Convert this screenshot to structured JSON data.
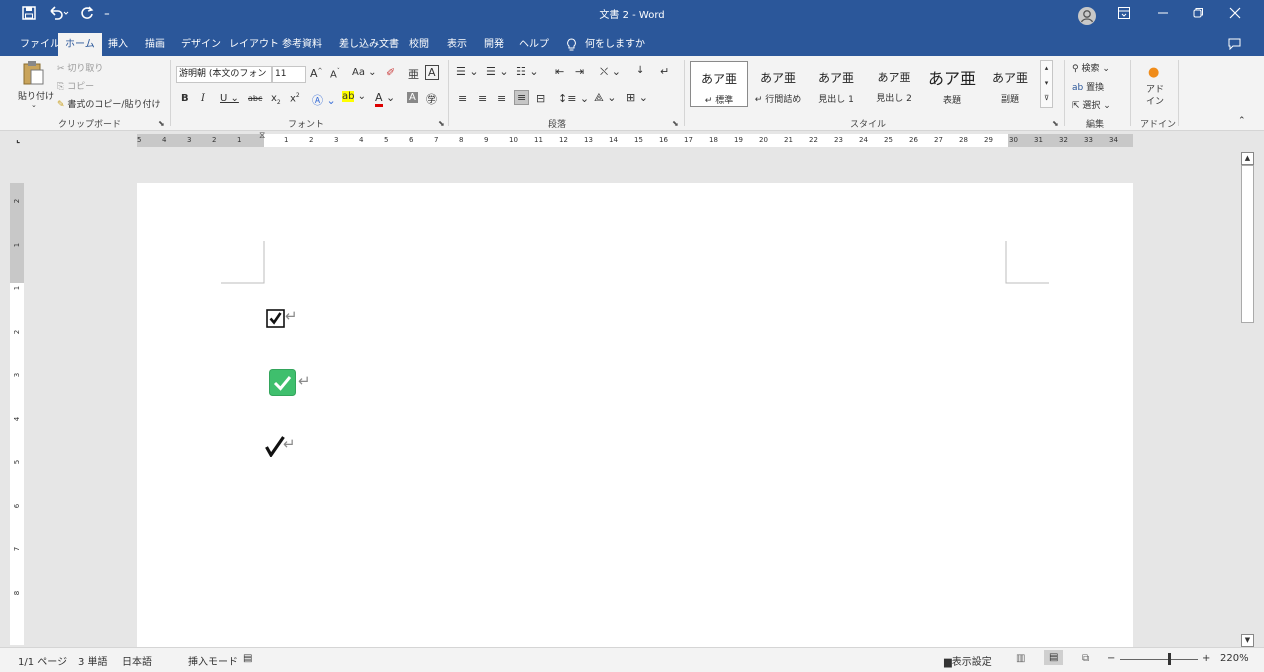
{
  "titlebar": {
    "title": "文書 2  -  Word",
    "save_icon": "floppy-icon",
    "undo_icon": "undo-icon",
    "redo_icon": "redo-icon",
    "qat_more": "⁼"
  },
  "tabs": [
    "ファイル",
    "ホーム",
    "挿入",
    "描画",
    "デザイン",
    "レイアウト",
    "参考資料",
    "差し込み文書",
    "校閲",
    "表示",
    "開発",
    "ヘルプ"
  ],
  "tell_me": "何をしますか",
  "clipboard": {
    "paste": "貼り付け",
    "cut": "切り取り",
    "copy": "コピー",
    "format_painter": "書式のコピー/貼り付け",
    "group": "クリップボード"
  },
  "font": {
    "name": "游明朝 (本文のフォン",
    "size": "11",
    "group": "フォント",
    "aa": "Aa"
  },
  "paragraph": {
    "group": "段落"
  },
  "styles": {
    "items": [
      {
        "sample": "あア亜",
        "name": "↵ 標準"
      },
      {
        "sample": "あア亜",
        "name": "↵ 行間詰め"
      },
      {
        "sample": "あア亜",
        "name": "見出し 1"
      },
      {
        "sample": "あア亜",
        "name": "見出し 2"
      },
      {
        "sample": "あア亜",
        "name": "表題"
      },
      {
        "sample": "あア亜",
        "name": "副題"
      }
    ],
    "group": "スタイル"
  },
  "editing": {
    "find": "検索",
    "replace": "置換",
    "select": "選択",
    "group": "編集"
  },
  "addins": {
    "label": "アド\nイン",
    "group": "アドイン"
  },
  "ruler": {
    "left_numbers": [
      "5",
      "4",
      "3",
      "2",
      "1"
    ],
    "right_numbers": [
      "1",
      "2",
      "3",
      "4",
      "5",
      "6",
      "7",
      "8",
      "9",
      "10",
      "11",
      "12",
      "13",
      "14",
      "15",
      "16",
      "17",
      "18",
      "19",
      "20",
      "21",
      "22",
      "23",
      "24",
      "25",
      "26",
      "27",
      "28",
      "29",
      "30",
      "31",
      "32",
      "33",
      "34"
    ]
  },
  "vruler": {
    "numbers": [
      "2",
      "1",
      "1",
      "2",
      "3",
      "4",
      "5",
      "6",
      "7",
      "8"
    ]
  },
  "document": {
    "lines": [
      {
        "symbol": "☑",
        "mark": "↵"
      },
      {
        "symbol": "✅",
        "mark": "↵"
      },
      {
        "symbol": "✔",
        "mark": "↵"
      }
    ]
  },
  "status": {
    "page": "1/1 ページ",
    "words": "3 単語",
    "language": "日本語",
    "mode": "挿入モード",
    "display": "表示設定",
    "zoom": "220%"
  },
  "colors": {
    "accent": "#2b579a",
    "check_green": "#3fbf6d"
  }
}
